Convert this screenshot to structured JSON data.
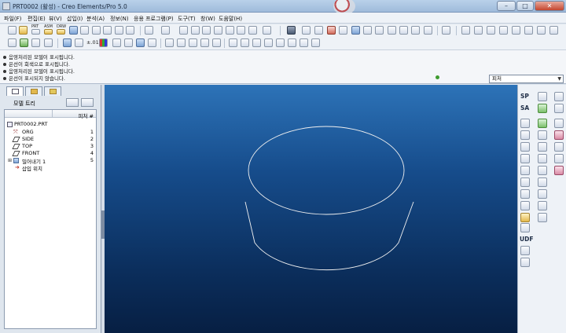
{
  "window": {
    "title": "PRT0002 (활성) - Creo Elements/Pro 5.0",
    "controls": [
      "–",
      "□",
      "✕"
    ]
  },
  "menu": [
    {
      "label": "파일(F)"
    },
    {
      "label": "편집(E)"
    },
    {
      "label": "뷰(V)"
    },
    {
      "label": "삽입(I)"
    },
    {
      "label": "분석(A)"
    },
    {
      "label": "정보(N)"
    },
    {
      "label": "응용 프로그램(P)"
    },
    {
      "label": "도구(T)"
    },
    {
      "label": "창(W)"
    },
    {
      "label": "도움말(H)"
    }
  ],
  "toolbar": {
    "small_labels": {
      "prt": "PRT",
      "asm": "ASM",
      "drw": "DRW",
      "zoom_ratio": "±.01"
    }
  },
  "messages": [
    "음영처리된 모델이 표시됩니다.",
    "은선이 회색으로 표시됩니다.",
    "음영처리된 모델이 표시됩니다.",
    "은선이 표시되지 않습니다."
  ],
  "filter": {
    "value": "피처"
  },
  "model_tree": {
    "title": "모델 트리",
    "column_header": "피처 #",
    "root": "PRT0002.PRT",
    "items": [
      {
        "label": "ORG",
        "num": "1",
        "icon": "csys-icon"
      },
      {
        "label": "SIDE",
        "num": "2",
        "icon": "datum-plane-icon"
      },
      {
        "label": "TOP",
        "num": "3",
        "icon": "datum-plane-icon"
      },
      {
        "label": "FRONT",
        "num": "4",
        "icon": "datum-plane-icon"
      },
      {
        "label": "밀어내기 1",
        "num": "5",
        "icon": "extrude-icon",
        "collapsed": true
      },
      {
        "label": "삽입 위치",
        "num": "",
        "icon": "insert-here-icon"
      }
    ]
  },
  "right_toolbar": {
    "sp_label": "SP",
    "sa_label": "SA",
    "udf_label": "UDF"
  },
  "colors": {
    "viewport_top": "#2d73b8",
    "viewport_bottom": "#071f43",
    "model_edge": "#f0f0f0"
  }
}
